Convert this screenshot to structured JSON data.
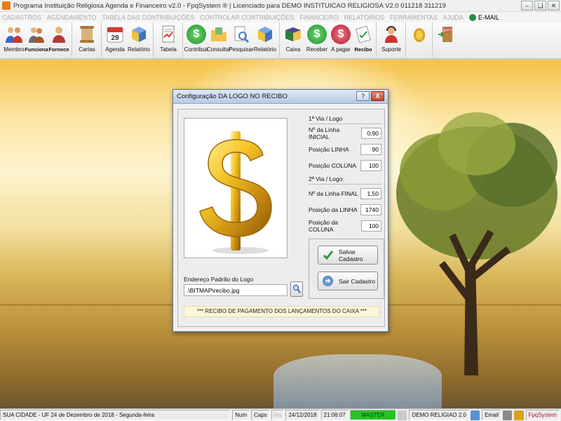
{
  "window": {
    "title": "Programa Instituição Religiosa Agenda e Financeiro v2.0 - FpqSystem ® | Licenciado para  DEMO INSTITUICAO RELIGIOSA V2.0 011218 311219",
    "minimize": "–",
    "restore": "❏",
    "close": "✕"
  },
  "menu": [
    {
      "label": "CADASTROS",
      "active": false
    },
    {
      "label": "AGENDAMENTO",
      "active": false
    },
    {
      "label": "TABELA DAS CONTRIBUIÇÕES",
      "active": false
    },
    {
      "label": "CONTROLAR CONTRIBUIÇÕES",
      "active": false
    },
    {
      "label": "FINANCEIRO",
      "active": false
    },
    {
      "label": "RELATÓRIOS",
      "active": false
    },
    {
      "label": "FERRAMENTAS",
      "active": false
    },
    {
      "label": "AJUDA",
      "active": false
    },
    {
      "label": "E-MAIL",
      "active": true
    }
  ],
  "toolbar": {
    "membro": "Membro",
    "funciona": "Funciona",
    "fornece": "Fornece",
    "cartas": "Cartas",
    "agenda": "Agenda",
    "relatorio1": "Relatório",
    "tabela": "Tabela",
    "contribuir": "Contribuir",
    "consultar": "Consultar",
    "pesquisar": "Pesquisar",
    "relatorio2": "Relatório",
    "caixa": "Caixa",
    "receber": "Receber",
    "apagar": "A pagar",
    "recibo": "Recibo",
    "suporte": "Suporte",
    "agenda_day": "29",
    "exit_sign": "EXIT"
  },
  "dialog": {
    "title": "Configuração DA LOGO NO RECIBO",
    "help": "?",
    "close": "X",
    "via1": {
      "header": "1ª Via / Logo",
      "rows": [
        {
          "label": "Nº da Linha INICIAL",
          "value": "0,90"
        },
        {
          "label": "Posição LINHA",
          "value": "90"
        },
        {
          "label": "Posição COLUNA",
          "value": "100"
        }
      ]
    },
    "via2": {
      "header": "2ª Via / Logo",
      "rows": [
        {
          "label": "Nº da Linha FINAL",
          "value": "1,50"
        },
        {
          "label": "Posição da LINHA",
          "value": "1740"
        },
        {
          "label": "Posição da COLUNA",
          "value": "100"
        }
      ]
    },
    "save_label": "Salvar Cadastro",
    "exit_label": "Sair Cadastro",
    "address_label": "Endereço Padrão do Logo",
    "address_value": ".\\BITMAP\\recibo.jpg",
    "note": "*** RECIBO DE PAGAMENTO DOS LANÇAMENTOS DO CAIXA ***"
  },
  "status": {
    "city": "SUA CIDADE - UF 24 de Dezembro de 2018 - Segunda-feira",
    "num": "Num",
    "caps": "Caps",
    "ins": "Ins",
    "date": "24/12/2018",
    "time": "21:06:07",
    "master": "MASTER",
    "version": "DEMO RELIGIAO 2.0",
    "email": "Email",
    "brand": "FpqSystem"
  },
  "colors": {
    "master_bg": "#27c427",
    "dollar_gold": "#e0a818",
    "close_red": "#c2452c"
  }
}
